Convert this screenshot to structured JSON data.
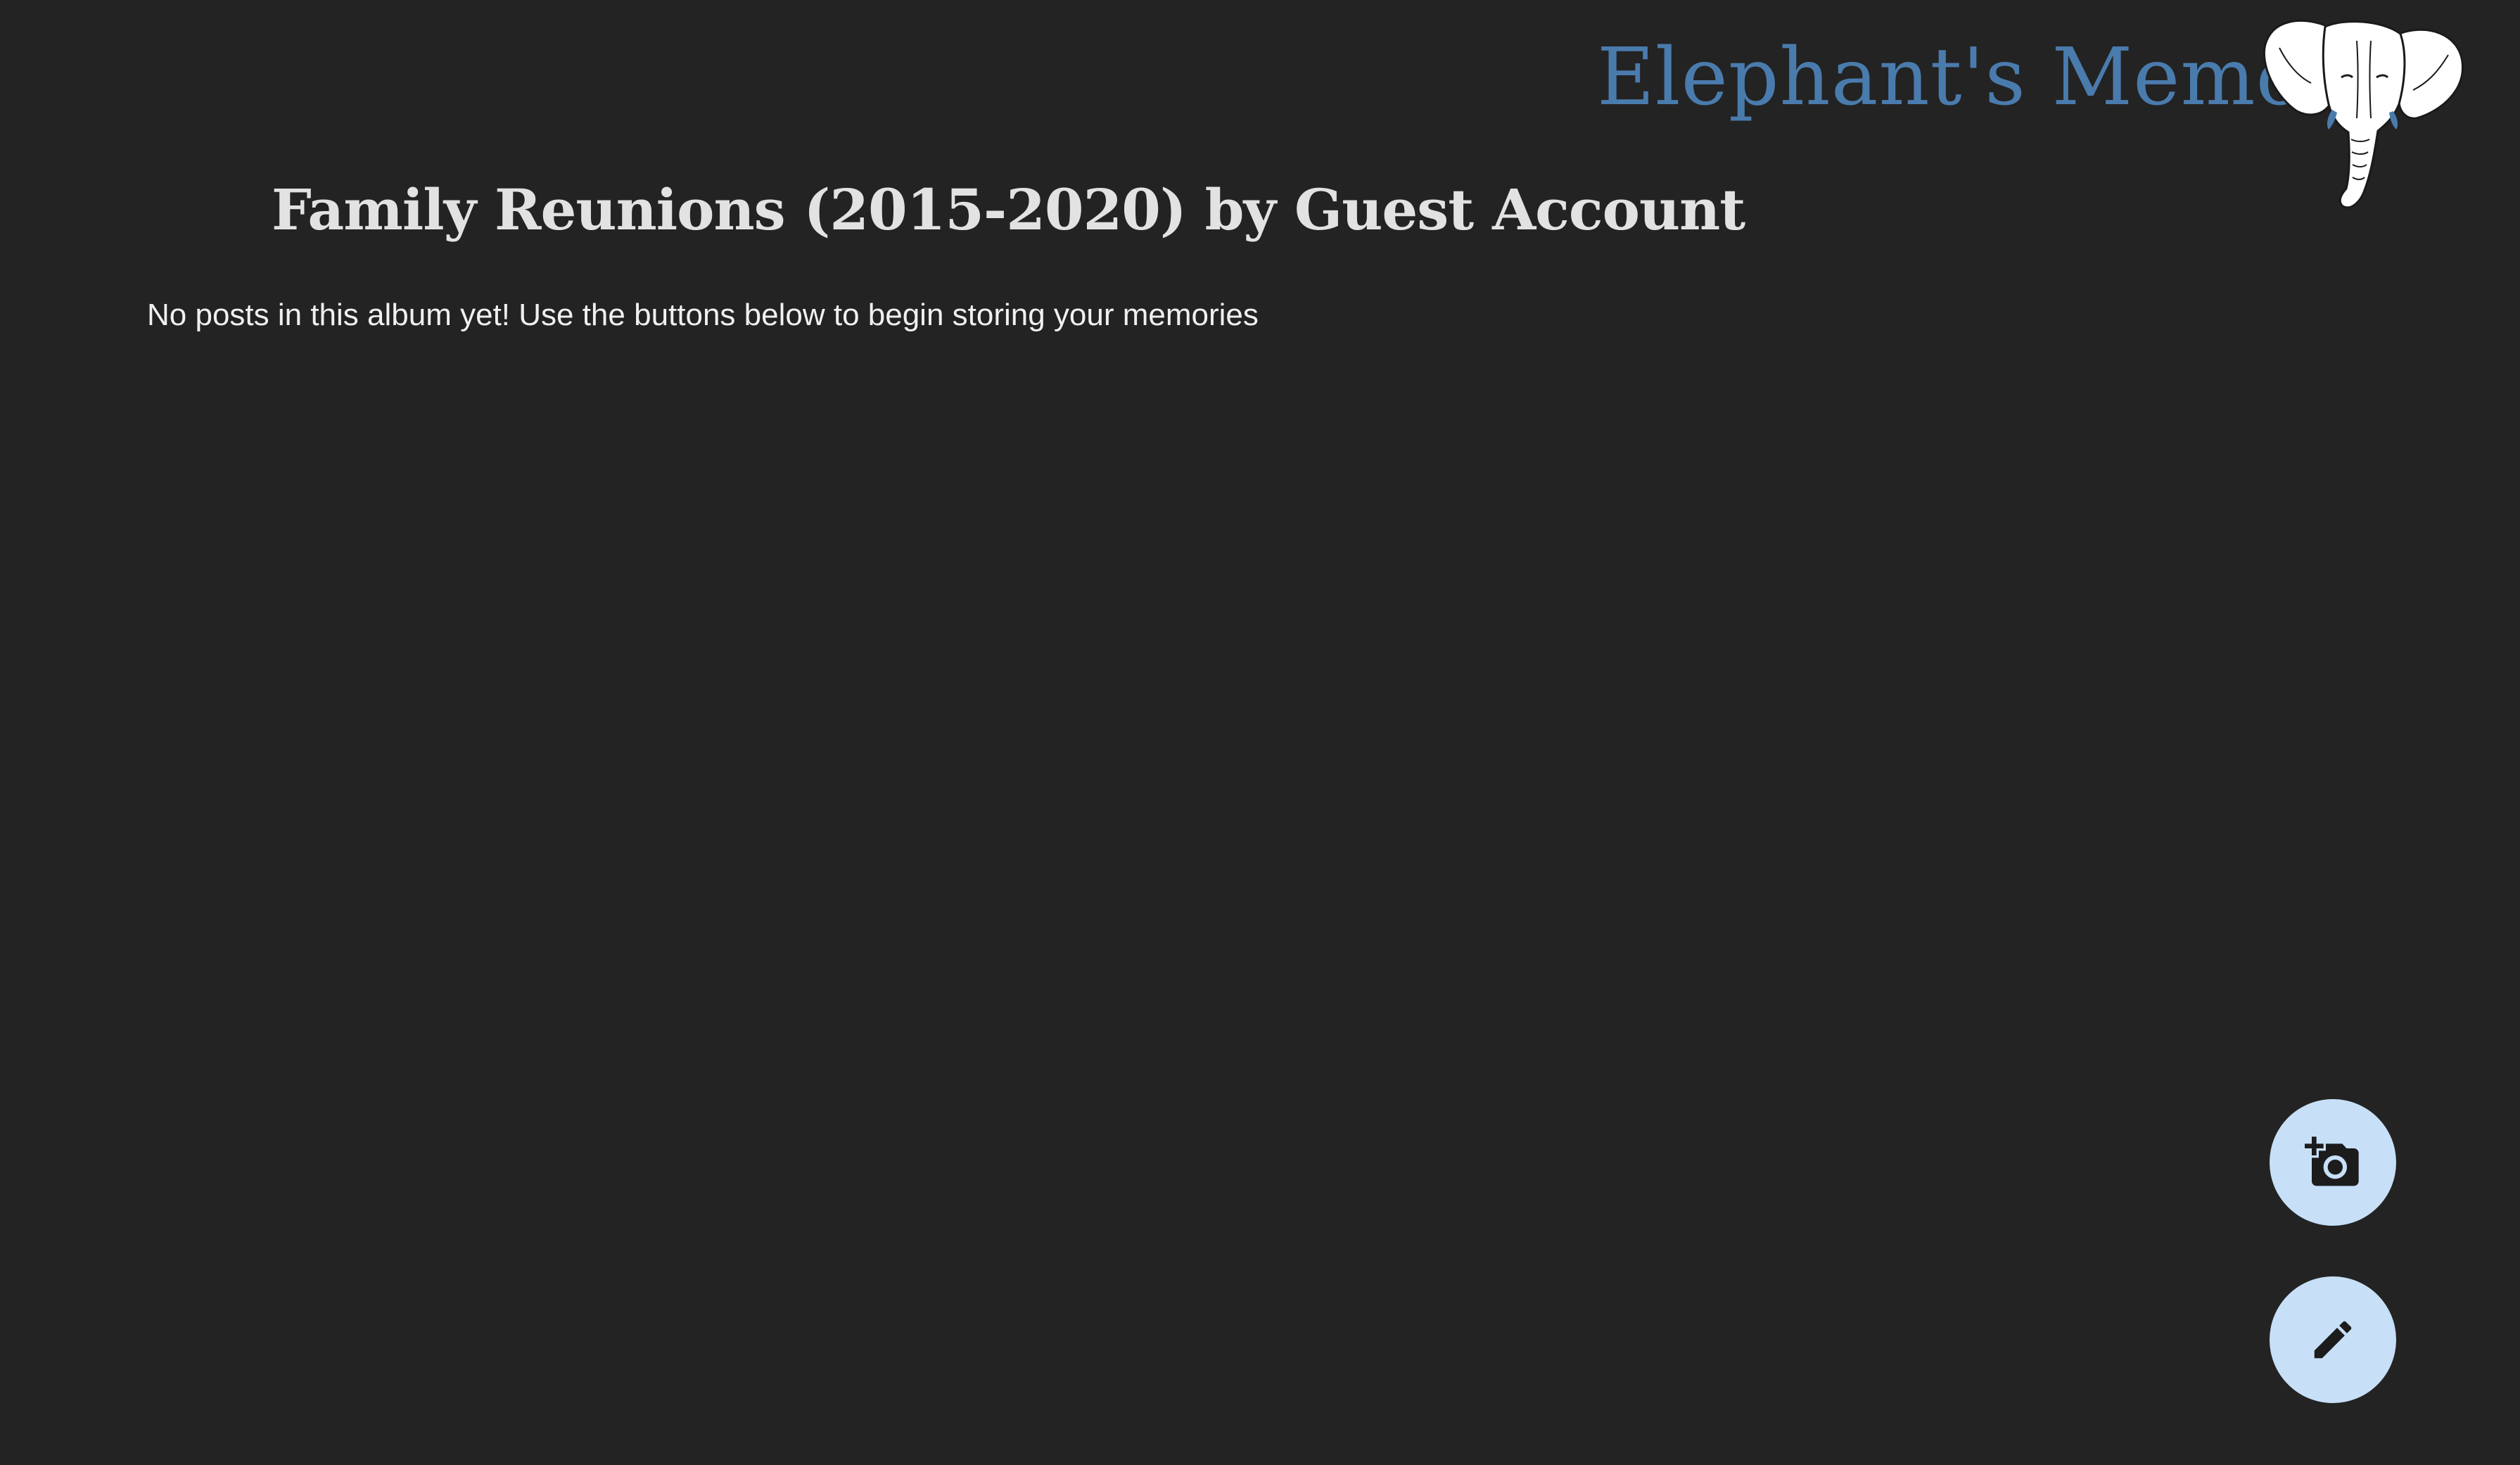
{
  "header": {
    "brand": "Elephant's Memory",
    "logo_icon": "elephant-head-logo",
    "brand_color": "#4a7bad"
  },
  "album": {
    "title": "Family Reunions (2015-2020) by Guest Account",
    "empty_message": "No posts in this album yet! Use the buttons below to begin storing your memories"
  },
  "actions": {
    "add_photo_icon": "add-a-photo-icon",
    "edit_icon": "pencil-icon",
    "button_color": "#c7e0f7"
  },
  "theme": {
    "background": "#232323",
    "title_color": "#e2e2e2",
    "text_color": "#f0f0f0"
  }
}
